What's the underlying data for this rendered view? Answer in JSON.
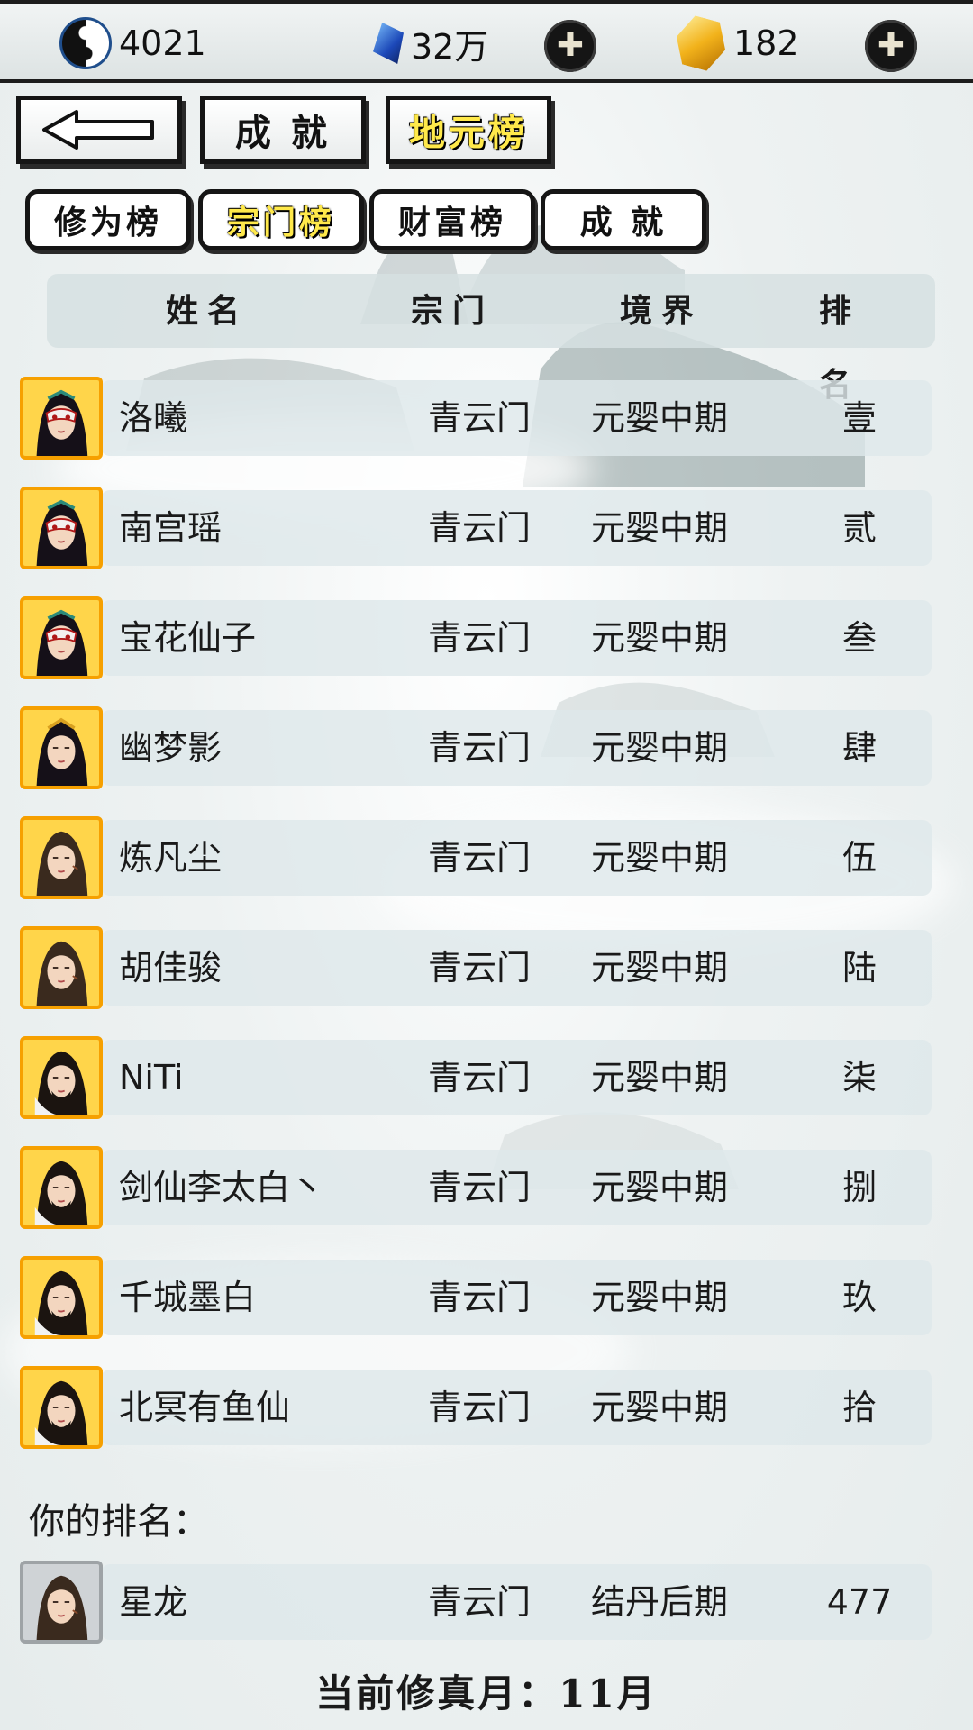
{
  "currency": {
    "taiji": "4021",
    "spirit_stone": "32万",
    "gold": "182",
    "add_symbol": "✚"
  },
  "main_tabs": [
    {
      "label": "",
      "icon": "back-arrow-icon"
    },
    {
      "label": "成 就",
      "active": false
    },
    {
      "label": "地元榜",
      "active": true
    }
  ],
  "sub_tabs": [
    {
      "label": "修为榜",
      "active": false
    },
    {
      "label": "宗门榜",
      "active": true
    },
    {
      "label": "财富榜",
      "active": false
    },
    {
      "label": "成 就",
      "active": false
    }
  ],
  "table": {
    "headers": {
      "name": "姓名",
      "sect": "宗门",
      "realm": "境界",
      "rank": "排名"
    },
    "rows": [
      {
        "name": "洛曦",
        "sect": "青云门",
        "realm": "元婴中期",
        "rank": "壹",
        "avatar": "female-masked"
      },
      {
        "name": "南宫瑶",
        "sect": "青云门",
        "realm": "元婴中期",
        "rank": "贰",
        "avatar": "female-masked"
      },
      {
        "name": "宝花仙子",
        "sect": "青云门",
        "realm": "元婴中期",
        "rank": "叁",
        "avatar": "female-masked"
      },
      {
        "name": "幽梦影",
        "sect": "青云门",
        "realm": "元婴中期",
        "rank": "肆",
        "avatar": "female"
      },
      {
        "name": "炼凡尘",
        "sect": "青云门",
        "realm": "元婴中期",
        "rank": "伍",
        "avatar": "young-male"
      },
      {
        "name": "胡佳骏",
        "sect": "青云门",
        "realm": "元婴中期",
        "rank": "陆",
        "avatar": "young-male"
      },
      {
        "name": "NiTi",
        "sect": "青云门",
        "realm": "元婴中期",
        "rank": "柒",
        "avatar": "bearded-male"
      },
      {
        "name": "剑仙李太白丶",
        "sect": "青云门",
        "realm": "元婴中期",
        "rank": "捌",
        "avatar": "bearded-male"
      },
      {
        "name": "千城墨白",
        "sect": "青云门",
        "realm": "元婴中期",
        "rank": "玖",
        "avatar": "bearded-male"
      },
      {
        "name": "北冥有鱼仙",
        "sect": "青云门",
        "realm": "元婴中期",
        "rank": "拾",
        "avatar": "bearded-male"
      }
    ]
  },
  "my_rank": {
    "label": "你的排名：",
    "name": "星龙",
    "sect": "青云门",
    "realm": "结丹后期",
    "rank": "477",
    "avatar": "young-male"
  },
  "footer": {
    "month_text": "当前修真月：11月"
  },
  "colors": {
    "active_tab_text": "#ffe94a",
    "avatar_frame": "#f6a000",
    "avatar_frame_self": "#9ea3a6"
  }
}
